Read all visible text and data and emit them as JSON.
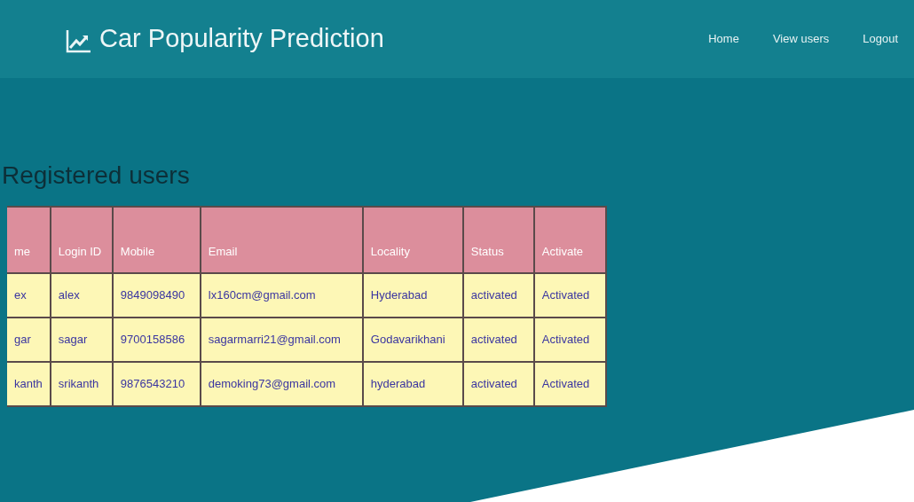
{
  "brand": {
    "title": "Car Popularity Prediction"
  },
  "nav": [
    "Home",
    "View users",
    "Logout"
  ],
  "heading": "Registered users",
  "table": {
    "columns": [
      "me",
      "Login ID",
      "Mobile",
      "Email",
      "Locality",
      "Status",
      "Activate"
    ],
    "rows": [
      [
        "ex",
        "alex",
        "9849098490",
        "lx160cm@gmail.com",
        "Hyderabad",
        "activated",
        "Activated"
      ],
      [
        "gar",
        "sagar",
        "9700158586",
        "sagarmarri21@gmail.com",
        "Godavarikhani",
        "activated",
        "Activated"
      ],
      [
        "kanth",
        "srikanth",
        "9876543210",
        "demoking73@gmail.com",
        "hyderabad",
        "activated",
        "Activated"
      ]
    ]
  }
}
